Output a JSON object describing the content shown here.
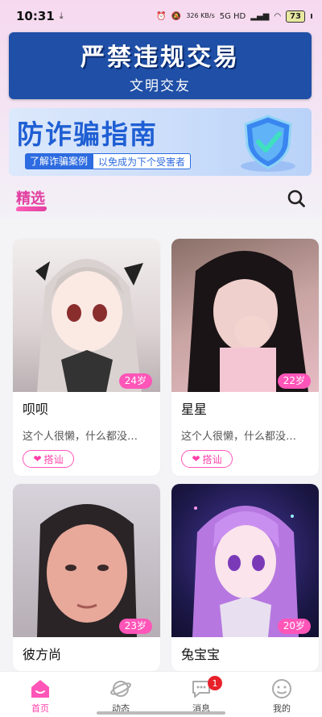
{
  "status": {
    "time": "10:31",
    "download": "⤓",
    "net": "326\nKB/s",
    "signal": "5G HD",
    "battery": "73"
  },
  "banner1": {
    "title": "严禁违规交易",
    "subtitle": "文明交友"
  },
  "banner2": {
    "title": "防诈骗指南",
    "tag_left": "了解诈骗案例",
    "tag_right": "以免成为下个受害者"
  },
  "section": {
    "title": "精选"
  },
  "users": [
    {
      "name": "呗呗",
      "age": "24岁",
      "bio": "这个人很懒，什么都没…",
      "action": "搭讪"
    },
    {
      "name": "星星",
      "age": "22岁",
      "bio": "这个人很懒，什么都没…",
      "action": "搭讪"
    },
    {
      "name": "彼方尚",
      "age": "23岁"
    },
    {
      "name": "兔宝宝",
      "age": "20岁"
    }
  ],
  "tabs": [
    {
      "label": "首页"
    },
    {
      "label": "动态"
    },
    {
      "label": "消息",
      "badge": "1"
    },
    {
      "label": "我的"
    }
  ],
  "colors": {
    "accent": "#ff55b8",
    "brand_blue": "#1f4fa6"
  }
}
